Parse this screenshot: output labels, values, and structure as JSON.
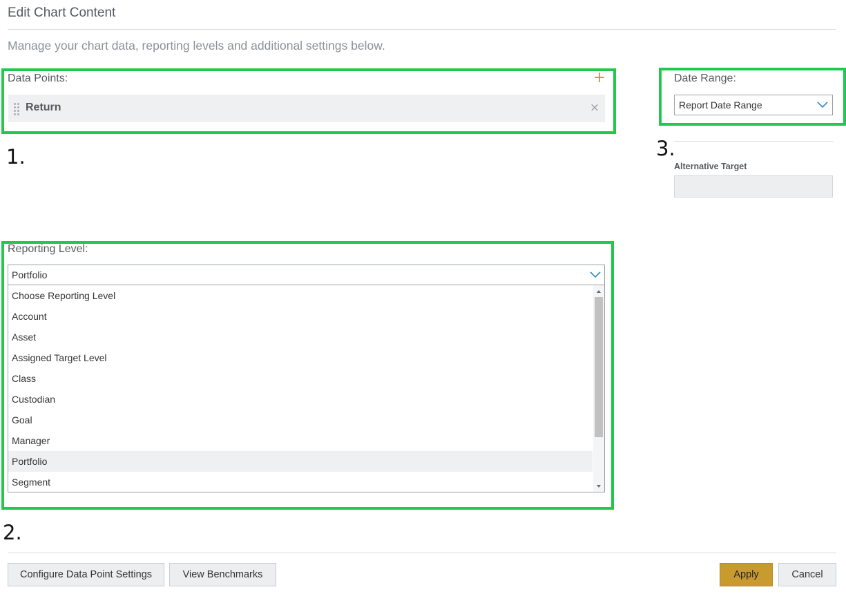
{
  "header": {
    "title": "Edit Chart Content",
    "subtitle": "Manage your chart data, reporting levels and additional settings below."
  },
  "annotations": [
    "1.",
    "2.",
    "3."
  ],
  "data_points": {
    "label": "Data Points:",
    "items": [
      {
        "name": "Return"
      }
    ]
  },
  "date_range": {
    "label": "Date Range:",
    "selected": "Report Date Range"
  },
  "alternative_target": {
    "label": "Alternative Target",
    "value": ""
  },
  "reporting_level": {
    "label": "Reporting Level:",
    "selected": "Portfolio",
    "options": [
      "Choose Reporting Level",
      "Account",
      "Asset",
      "Assigned Target Level",
      "Class",
      "Custodian",
      "Goal",
      "Manager",
      "Portfolio",
      "Segment"
    ],
    "highlighted_index": 8
  },
  "footer": {
    "configure_label": "Configure Data Point Settings",
    "benchmarks_label": "View Benchmarks",
    "apply_label": "Apply",
    "cancel_label": "Cancel"
  },
  "colors": {
    "highlight_box": "#21c94a",
    "accent": "#c99a2e",
    "chevron": "#3a8fc7"
  }
}
